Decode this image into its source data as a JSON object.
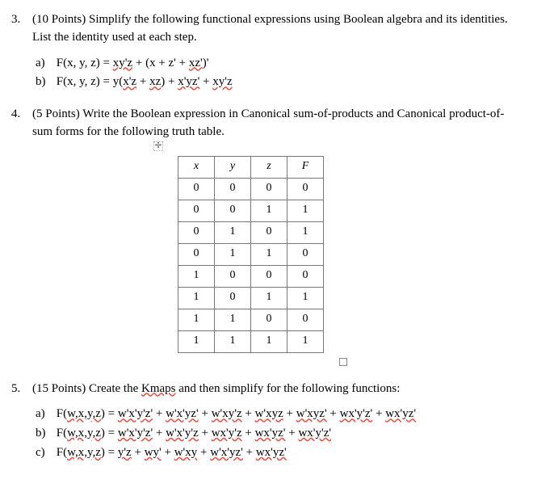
{
  "q3": {
    "num": "3.",
    "prompt_a": "(10 Points) Simplify the following functional expressions using Boolean algebra and its identities.",
    "prompt_b": "List the identity used at each step.",
    "a_label": "a)",
    "a_lhs": "F(x, y, z) =  ",
    "a_rhs_1": "xy'z",
    "a_rhs_2": " + (x + z' + ",
    "a_rhs_3": "xz'",
    "a_rhs_4": ")'",
    "b_label": "b)",
    "b_lhs": "F(x, y, z) =   y(",
    "b_rhs_1": "x'z",
    "b_rhs_2": " + ",
    "b_rhs_3": "xz",
    "b_rhs_4": ") + ",
    "b_rhs_5": "x'yz'",
    "b_rhs_6": " + ",
    "b_rhs_7": "xy'z"
  },
  "q4": {
    "num": "4.",
    "prompt_a": "(5 Points) Write the Boolean expression in Canonical sum-of-products and Canonical product-of-",
    "prompt_b": "sum forms for the following truth table.",
    "headers": [
      "x",
      "y",
      "z",
      "F"
    ],
    "rows": [
      [
        "0",
        "0",
        "0",
        "0"
      ],
      [
        "0",
        "0",
        "1",
        "1"
      ],
      [
        "0",
        "1",
        "0",
        "1"
      ],
      [
        "0",
        "1",
        "1",
        "0"
      ],
      [
        "1",
        "0",
        "0",
        "0"
      ],
      [
        "1",
        "0",
        "1",
        "1"
      ],
      [
        "1",
        "1",
        "0",
        "0"
      ],
      [
        "1",
        "1",
        "1",
        "1"
      ]
    ]
  },
  "q5": {
    "num": "5.",
    "prompt_a": "(15 Points) Create the ",
    "prompt_kmaps": "Kmaps",
    "prompt_b": " and then simplify for the following functions:",
    "a_label": "a)",
    "a_lhs": "F(",
    "a_vars": "w,x,y,z",
    "a_eq": ") = ",
    "a_t": [
      "w'x'y'z'",
      " + ",
      "w'x'yz'",
      " + ",
      "w'xy'z",
      " + ",
      "w'xyz",
      " + ",
      "w'xyz'",
      " + ",
      "wx'y'z'",
      " + ",
      "wx'yz'"
    ],
    "b_label": "b)",
    "b_lhs": "F(",
    "b_vars": "w,x,y,z",
    "b_eq": ") = ",
    "b_t": [
      "w'x'y'z'",
      " + ",
      "w'x'y'z",
      " + ",
      "wx'y'z",
      " + ",
      "wx'yz'",
      " + ",
      "wx'y'z'"
    ],
    "c_label": "c)",
    "c_lhs": "F(",
    "c_vars": "w,x,y,z",
    "c_eq": ") = ",
    "c_t": [
      "y'z",
      " + ",
      "wy'",
      " + ",
      "w'xy",
      " + ",
      "w'x'yz'",
      " + ",
      "wx'yz'"
    ]
  }
}
